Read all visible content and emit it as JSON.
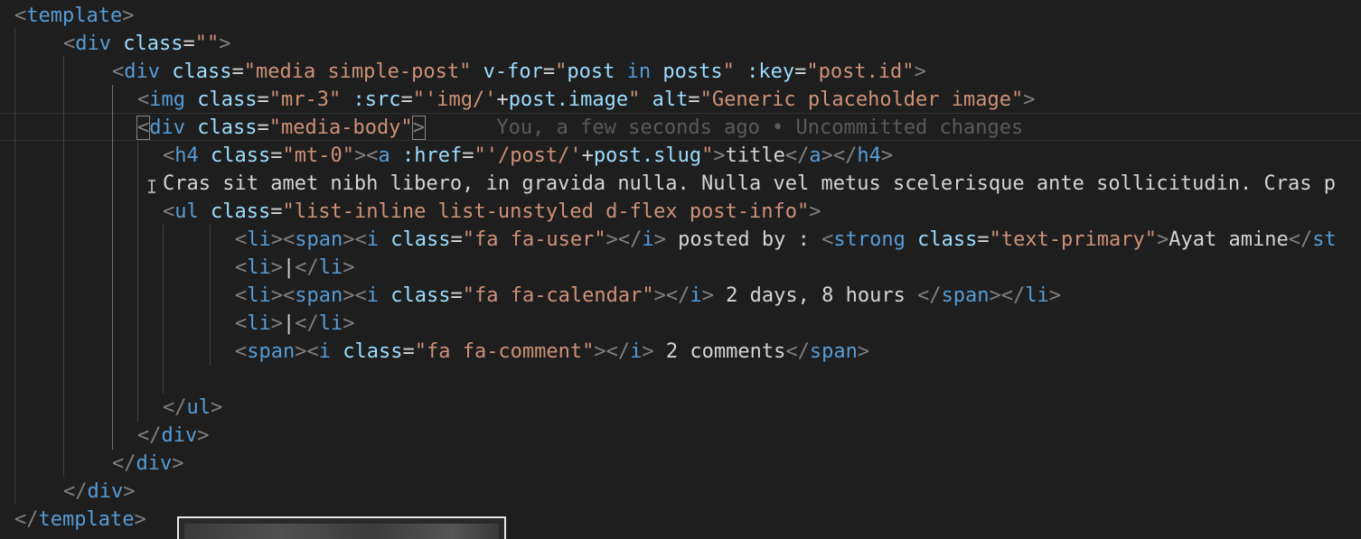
{
  "editor": {
    "blame_annotation": "You, a few seconds ago • Uncommitted changes",
    "lines": {
      "l1": {
        "open": "<",
        "tag": "template",
        "close": ">"
      },
      "l2": {
        "open": "<",
        "tag": "div",
        "a1": "class",
        "eq": "=",
        "v1": "\"\"",
        "close": ">"
      },
      "l3": {
        "open": "<",
        "tag": "div",
        "a1": "class",
        "v1": "\"media simple-post\"",
        "a2": "v-for",
        "q1": "\"",
        "s1": "post",
        "kw": "in",
        "s2": "posts",
        "q2": "\"",
        "a3": ":key",
        "v3": "\"post.id\"",
        "close": ">"
      },
      "l4": {
        "open": "<",
        "tag": "img",
        "a1": "class",
        "v1": "\"mr-3\"",
        "a2": ":src",
        "q1": "\"",
        "s1": "'img/'",
        "plus": "+",
        "expr": "post.image",
        "q2": "\"",
        "a3": "alt",
        "v3": "\"Generic placeholder image\"",
        "close": ">"
      },
      "l5": {
        "open": "<",
        "tag": "div",
        "a1": "class",
        "v1": "\"media-body\"",
        "close": ">"
      },
      "l6": {
        "open": "<",
        "tag": "h4",
        "a1": "class",
        "v1": "\"mt-0\"",
        "close1": "><",
        "tag2": "a",
        "a2": ":href",
        "q1": "\"",
        "s1": "'/post/'",
        "plus": "+",
        "expr": "post.slug",
        "q2": "\"",
        "close2": ">",
        "text": "title",
        "end1": "</",
        "tag3": "a",
        "mid": "></",
        "tag4": "h4",
        "close3": ">"
      },
      "l7": {
        "text": "Cras sit amet nibh libero, in gravida nulla. Nulla vel metus scelerisque ante sollicitudin. Cras p"
      },
      "l8": {
        "open": "<",
        "tag": "ul",
        "a1": "class",
        "v1": "\"list-inline list-unstyled d-flex post-info\"",
        "close": ">"
      },
      "l9": {
        "o1": "<",
        "t1": "li",
        "m1": "><",
        "t2": "span",
        "m2": "><",
        "t3": "i",
        "a1": "class",
        "v1": "\"fa fa-user\"",
        "m3": "></",
        "t4": "i",
        "m4": ">",
        "text": " posted by : ",
        "o2": "<",
        "t5": "strong",
        "a2": "class",
        "v2": "\"text-primary\"",
        "m5": ">",
        "text2": "Ayat amine",
        "o3": "</",
        "t6": "st"
      },
      "l10": {
        "o1": "<",
        "t1": "li",
        "m1": ">",
        "text": "|",
        "o2": "</",
        "t2": "li",
        "m2": ">"
      },
      "l11": {
        "o1": "<",
        "t1": "li",
        "m1": "><",
        "t2": "span",
        "m2": "><",
        "t3": "i",
        "a1": "class",
        "v1": "\"fa fa-calendar\"",
        "m3": "></",
        "t4": "i",
        "m4": ">",
        "text": " 2 days, 8 hours ",
        "o2": "</",
        "t5": "span",
        "m5": "></",
        "t6": "li",
        "m6": ">"
      },
      "l12": {
        "o1": "<",
        "t1": "li",
        "m1": ">",
        "text": "|",
        "o2": "</",
        "t2": "li",
        "m2": ">"
      },
      "l13": {
        "o1": "<",
        "t1": "span",
        "m1": "><",
        "t2": "i",
        "a1": "class",
        "v1": "\"fa fa-comment\"",
        "m2": "></",
        "t3": "i",
        "m3": ">",
        "text": " 2 comments",
        "o2": "</",
        "t4": "span",
        "m4": ">"
      },
      "l15": {
        "open": "</",
        "tag": "ul",
        "close": ">"
      },
      "l16": {
        "open": "</",
        "tag": "div",
        "close": ">"
      },
      "l17": {
        "open": "</",
        "tag": "div",
        "close": ">"
      },
      "l18": {
        "open": "</",
        "tag": "div",
        "close": ">"
      },
      "l19": {
        "open": "</",
        "tag": "template",
        "close": ">"
      }
    }
  },
  "colors": {
    "background": "#1e1e1e",
    "tag": "#569cd6",
    "punctuation": "#808080",
    "attribute": "#9cdcfe",
    "string": "#ce9178",
    "text": "#d4d4d4",
    "blame": "#5a5a5a"
  }
}
